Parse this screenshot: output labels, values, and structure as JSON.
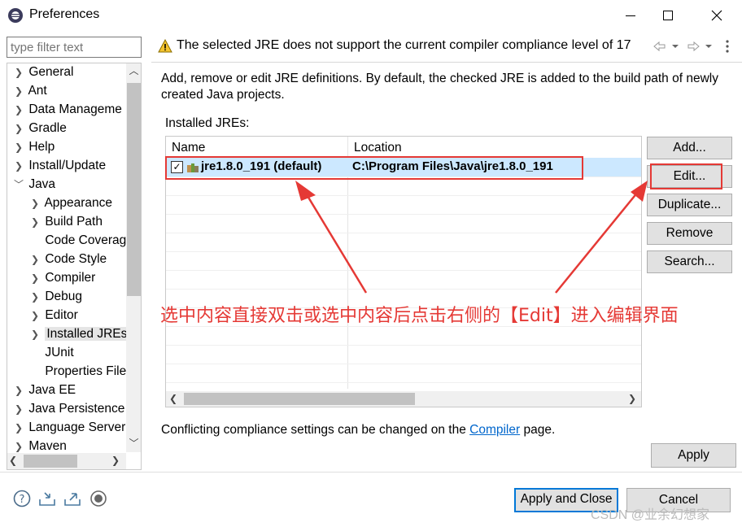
{
  "window": {
    "title": "Preferences",
    "controls": {
      "minimize": "minimize-icon",
      "maximize": "maximize-icon",
      "close": "close-icon"
    }
  },
  "sidebar": {
    "filter_placeholder": "type filter text",
    "items": [
      {
        "label": "General",
        "level": 0,
        "expanded": false
      },
      {
        "label": "Ant",
        "level": 0,
        "expanded": false
      },
      {
        "label": "Data Manageme",
        "level": 0,
        "expanded": false
      },
      {
        "label": "Gradle",
        "level": 0,
        "expanded": false
      },
      {
        "label": "Help",
        "level": 0,
        "expanded": false
      },
      {
        "label": "Install/Update",
        "level": 0,
        "expanded": false
      },
      {
        "label": "Java",
        "level": 0,
        "expanded": true
      },
      {
        "label": "Appearance",
        "level": 1,
        "expanded": false
      },
      {
        "label": "Build Path",
        "level": 1,
        "expanded": false
      },
      {
        "label": "Code Coverag",
        "level": 1,
        "leaf": true
      },
      {
        "label": "Code Style",
        "level": 1,
        "expanded": false
      },
      {
        "label": "Compiler",
        "level": 1,
        "expanded": false
      },
      {
        "label": "Debug",
        "level": 1,
        "expanded": false
      },
      {
        "label": "Editor",
        "level": 1,
        "expanded": false
      },
      {
        "label": "Installed JREs",
        "level": 1,
        "expanded": false,
        "selected": true
      },
      {
        "label": "JUnit",
        "level": 1,
        "leaf": true
      },
      {
        "label": "Properties File",
        "level": 1,
        "leaf": true
      },
      {
        "label": "Java EE",
        "level": 0,
        "expanded": false
      },
      {
        "label": "Java Persistence",
        "level": 0,
        "expanded": false
      },
      {
        "label": "Language Server",
        "level": 0,
        "expanded": false
      },
      {
        "label": "Maven",
        "level": 0,
        "expanded": false
      }
    ]
  },
  "header": {
    "message": "The selected JRE does not support the current compiler compliance level of 17",
    "warning_icon": "warning-icon"
  },
  "main": {
    "description": "Add, remove or edit JRE definitions. By default, the checked JRE is added to the build path of newly created Java projects.",
    "installed_label": "Installed JREs:",
    "columns": [
      "Name",
      "Location"
    ],
    "rows": [
      {
        "name": "jre1.8.0_191 (default)",
        "location": "C:\\Program Files\\Java\\jre1.8.0_191",
        "checked": true
      }
    ],
    "buttons": {
      "add": "Add...",
      "edit": "Edit...",
      "duplicate": "Duplicate...",
      "remove": "Remove",
      "search": "Search..."
    },
    "annotation": "选中内容直接双击或选中内容后点击右侧的【Edit】进入编辑界面",
    "conflict_prefix": "Conflicting compliance settings can be changed on the ",
    "conflict_link": "Compiler",
    "conflict_suffix": " page.",
    "apply": "Apply"
  },
  "footer": {
    "apply_close": "Apply and Close",
    "cancel": "Cancel",
    "watermark": "CSDN @业余幻想家"
  },
  "colors": {
    "annotation_red": "#e53935",
    "selection_blue": "#cce8ff",
    "link_blue": "#0066cc",
    "default_button_border": "#0078d7"
  }
}
